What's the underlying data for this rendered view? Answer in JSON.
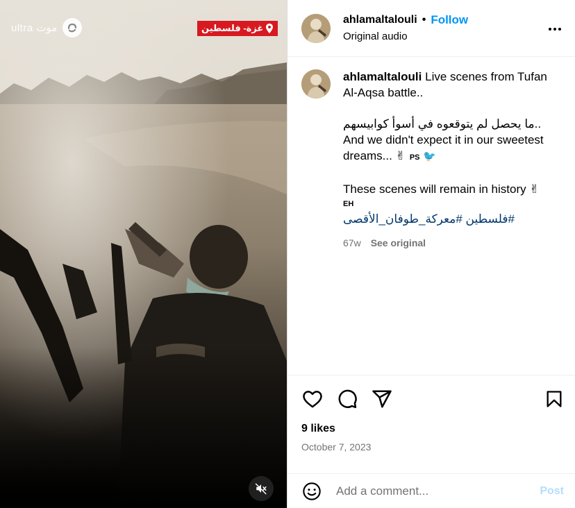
{
  "video": {
    "watermark_text": "ultra موت",
    "location_badge": "غزة- فلسطين"
  },
  "header": {
    "username": "ahlamaltalouli",
    "separator": "•",
    "follow_label": "Follow",
    "audio_label": "Original audio"
  },
  "caption": {
    "username": "ahlamaltalouli",
    "line1": "Live scenes from Tufan Al-Aqsa battle..",
    "line2": "..ما يحصل لم يتوقعوه في أسوأ كوابيسهم",
    "line3": "And we didn't expect it in our sweetest dreams... ✌",
    "line3_tag": "PS",
    "line4": "These scenes will remain in history ✌",
    "line4_tag": "EH",
    "hashtags": "#فلسطين #معركة_طوفان_الأقصى",
    "age": "67w",
    "see_original": "See original"
  },
  "actions": {
    "likes": "9 likes",
    "date": "October 7, 2023"
  },
  "comment": {
    "placeholder": "Add a comment...",
    "post_label": "Post"
  },
  "colors": {
    "follow_blue": "#0095f6",
    "hashtag_blue": "#00376b",
    "post_disabled": "#b2dffc",
    "badge_red": "#d71920",
    "secondary_text": "#737373"
  },
  "icons": [
    "map-pin-icon",
    "mute-icon",
    "heart-icon",
    "comment-icon",
    "share-icon",
    "bookmark-icon",
    "emoji-icon",
    "more-icon",
    "bird-emoji"
  ]
}
